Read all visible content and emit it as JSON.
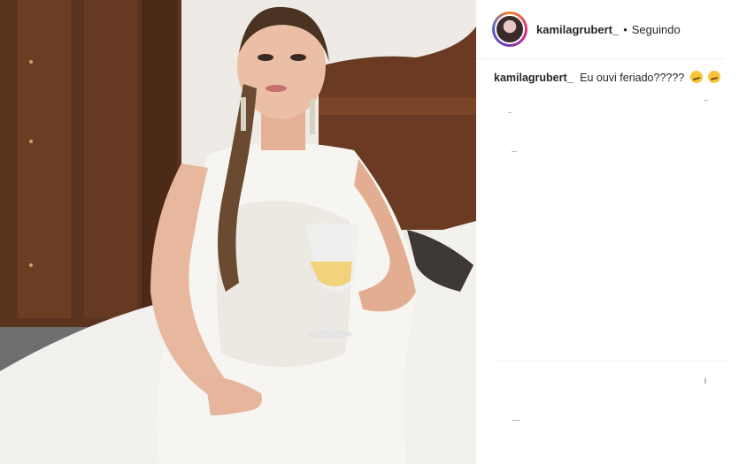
{
  "post": {
    "image_alt": "",
    "username": "kamilagrubert_",
    "separator": "•",
    "follow_state": "Seguindo"
  },
  "caption": {
    "username": "kamilagrubert_",
    "text": "Eu ouvi feriado?????",
    "emojis": [
      "thinking-face-icon",
      "thinking-face-icon"
    ]
  },
  "colors": {
    "text": "#262626",
    "divider": "#efefef",
    "ring_gradient": [
      "#f58529",
      "#dd2a7b",
      "#8134af",
      "#515bd4"
    ]
  }
}
